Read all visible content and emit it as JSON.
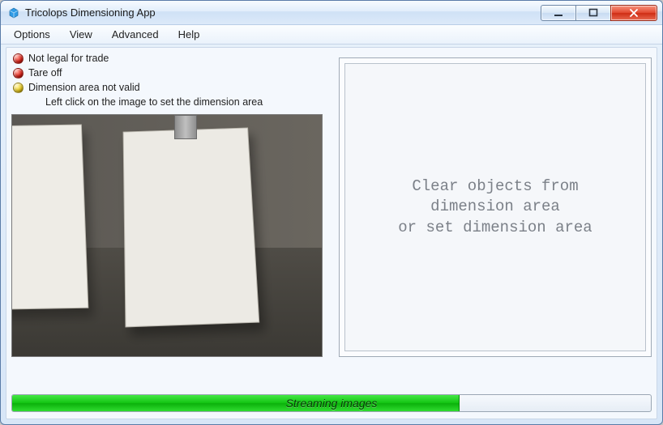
{
  "window": {
    "title": "Tricolops Dimensioning App"
  },
  "menu": {
    "items": [
      "Options",
      "View",
      "Advanced",
      "Help"
    ]
  },
  "status": {
    "lines": [
      {
        "led": "red",
        "text": "Not legal for trade"
      },
      {
        "led": "red",
        "text": "Tare off"
      },
      {
        "led": "yellow",
        "text": "Dimension area not valid"
      }
    ],
    "hint": "Left click on the image to set the dimension area"
  },
  "info_panel": {
    "message": "Clear objects from\ndimension area\nor set dimension area"
  },
  "progress": {
    "label": "Streaming images",
    "percent": 70
  },
  "colors": {
    "led_red": "#e62117",
    "led_yellow": "#f2d21a",
    "progress_green": "#14c514"
  }
}
